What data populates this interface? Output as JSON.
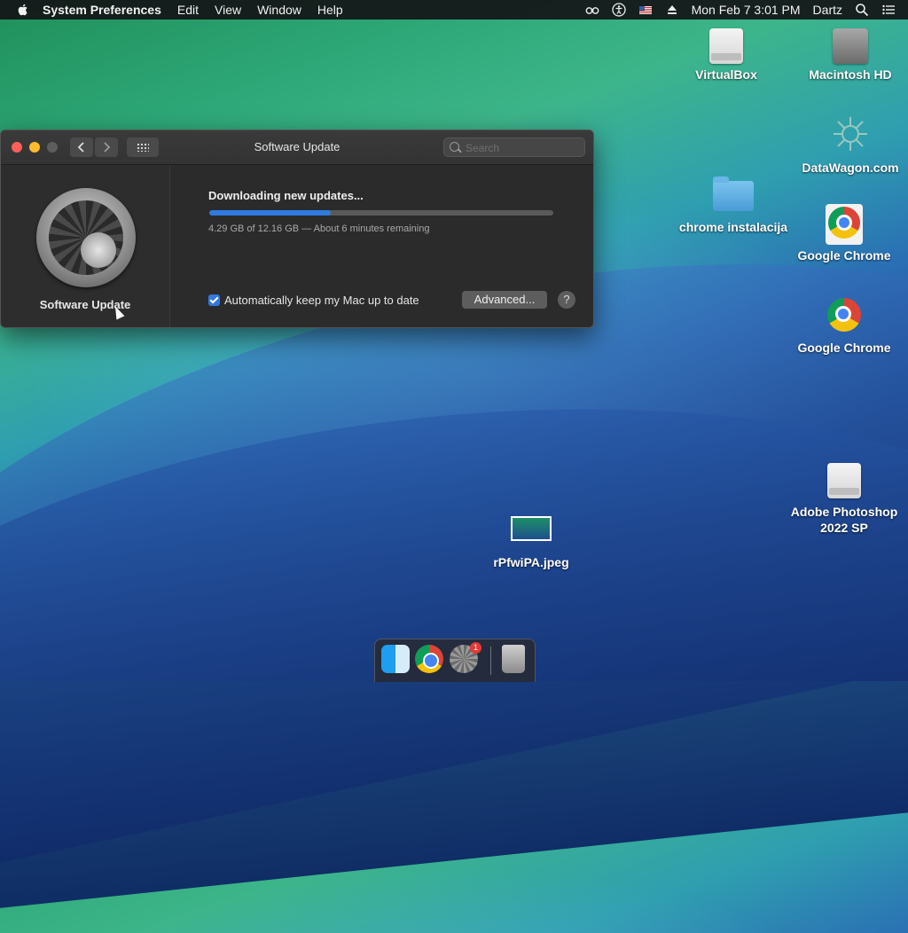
{
  "menubar": {
    "app_name": "System Preferences",
    "menus": [
      "Edit",
      "View",
      "Window",
      "Help"
    ],
    "datetime": "Mon Feb 7  3:01 PM",
    "user": "Dartz"
  },
  "desktop": {
    "icons": [
      {
        "label": "VirtualBox"
      },
      {
        "label": "Macintosh HD"
      },
      {
        "label": "DataWagon.com"
      },
      {
        "label": "chrome instalacija"
      },
      {
        "label": "Google Chrome"
      },
      {
        "label": "Google Chrome"
      },
      {
        "label": "Adobe Photoshop 2022 SP"
      },
      {
        "label": "rPfwiPA.jpeg"
      }
    ]
  },
  "window": {
    "title": "Software Update",
    "search_placeholder": "Search",
    "sidebar_label": "Software Update",
    "download_title": "Downloading new updates...",
    "download_status": "4.29 GB of 12.16 GB — About 6 minutes remaining",
    "progress_fraction": 0.353,
    "auto_update_label": "Automatically keep my Mac up to date",
    "auto_update_checked": true,
    "advanced_button": "Advanced...",
    "help_button": "?"
  },
  "dock": {
    "prefs_badge": "1"
  },
  "colors": {
    "accent": "#2f7be0",
    "window_bg": "#2b2b2b"
  }
}
